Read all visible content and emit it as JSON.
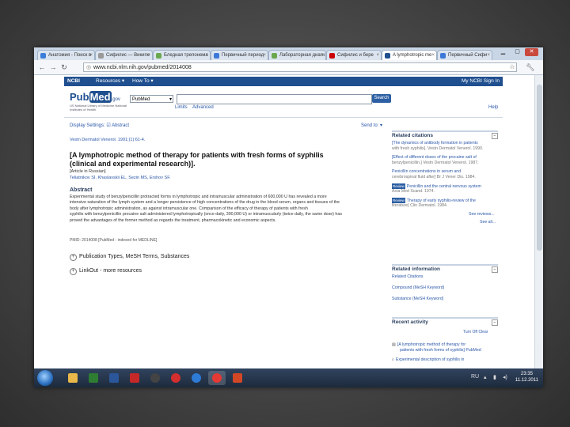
{
  "browser": {
    "tabs": [
      {
        "label": "Анатомия - Поиск в",
        "color": "#3b7dd8"
      },
      {
        "label": "Сифилис — Википе",
        "color": "#999999"
      },
      {
        "label": "Бледная трепонема",
        "color": "#6aa84f"
      },
      {
        "label": "Первичный период",
        "color": "#3c78d8"
      },
      {
        "label": "Лабораторная диагн",
        "color": "#6aa84f"
      },
      {
        "label": "Сифилис и бере",
        "color": "#cc0000"
      },
      {
        "label": "A lymphotropic me",
        "color": "#1f4f8f"
      },
      {
        "label": "Первичный Сифи",
        "color": "#3c78d8"
      }
    ],
    "url": "www.ncbi.nlm.nih.gov/pubmed/2014008",
    "back_icon": "back-arrow-icon",
    "forward_icon": "forward-arrow-icon",
    "reload_icon": "reload-icon"
  },
  "ncbi": {
    "brand": "NCBI",
    "resources": "Resources ▾",
    "howto": "How To ▾",
    "signin": "My NCBI  Sign In"
  },
  "pubmed": {
    "logo_a": "Pub",
    "logo_b": "Med",
    "logo_c": ".gov",
    "sublines": "US National Library of Medicine National Institutes of Health",
    "db_value": "PubMed",
    "search_button": "Search",
    "limits": "Limits",
    "advanced": "Advanced",
    "help": "Help"
  },
  "toolbar": {
    "display": "Display Settings: ☑ Abstract",
    "send_to": "Send to: ▾"
  },
  "article": {
    "journal": "Vestn Dermatol Venerol. 1991;(1):61-4.",
    "title": "[A lymphotropic method of therapy for patients with fresh forms of syphilis (clinical and experimental research)].",
    "lang": "[Article in Russian]",
    "authors": "Teliatnikov SI, Khaslavskii EL, Sezin MS, Ershov SF.",
    "abstract_label": "Abstract",
    "abstract_lines": [
      "Experimental study of benzylpenicillin protracted forms in lymphotropic and intramuscular administration of 600,000 U has revealed a more",
      "intensive saturation of the lymph system and a longer persistence of high concentrations of the drug in the blood serum, organs and tissues of the",
      "body after lymphotropic administration, as against intramuscular one. Comparison of the efficacy of therapy of patients with fresh",
      "syphilis with benzylpenicillin procaine salt administered lymphotropically (once daily, 300,000 U) or intramuscularly (twice daily, the same dose) has",
      "proved the advantages of the former method as regards the treatment, pharmacokinetic and economic aspects."
    ],
    "pmid": "PMID: 2014008 [PubMed - indexed for MEDLINE]",
    "section1": "Publication Types, MeSH Terms, Substances",
    "section2": "LinkOut - more resources"
  },
  "related": {
    "title": "Related citations",
    "items": [
      {
        "text": "[The dynamics of antibody formation in patients",
        "sub": "with fresh syphilis]. Vestn Dermatol Venerol. 1990."
      },
      {
        "text": "[Effect of different doses of the procaine salt of",
        "sub": "benzylpenicillin.] Vestn Dermatol Venerol. 1987."
      },
      {
        "text": "Penicillin concentrations in serum and",
        "sub": "cerebrospinal fluid after] Br J Vener Dis. 1984."
      },
      {
        "text": "Penicillin and the central nervous system",
        "sub": "Acta Med Scand. 1974.",
        "free": "Review"
      },
      {
        "text": "Therapy of early syphilis-review of the",
        "sub": "literature] Clin Dermatol. 1984.",
        "free": "Review"
      }
    ],
    "see_reviews": "See reviews...",
    "see_all": "See all..."
  },
  "related_info": {
    "title": "Related information",
    "items": [
      "Related Citations",
      "Compound (MeSH Keyword)",
      "Substance (MeSH Keyword)"
    ]
  },
  "recent": {
    "title": "Recent activity",
    "turn_off": "Turn Off  Clear",
    "item1a": "[A lymphotropic method of therapy for",
    "item1b": "patients with fresh forms of syphilis] PubMed",
    "item2": "Experimental description of syphilis in"
  },
  "taskbar": {
    "time": "23:35",
    "date": "11.12.2011",
    "lang": "RU",
    "app_icons": [
      {
        "name": "explorer-icon",
        "color": "#e8b84a"
      },
      {
        "name": "excel-icon",
        "color": "#2e7d32"
      },
      {
        "name": "word-icon",
        "color": "#2b579a"
      },
      {
        "name": "acrobat-icon",
        "color": "#c62828"
      },
      {
        "name": "media-icon",
        "color": "#444444"
      },
      {
        "name": "opera-icon",
        "color": "#d32f2f"
      },
      {
        "name": "network-icon",
        "color": "#2e7bd6"
      },
      {
        "name": "chrome-icon",
        "color": "#e53935"
      },
      {
        "name": "powerpoint-icon",
        "color": "#d24726"
      }
    ]
  }
}
